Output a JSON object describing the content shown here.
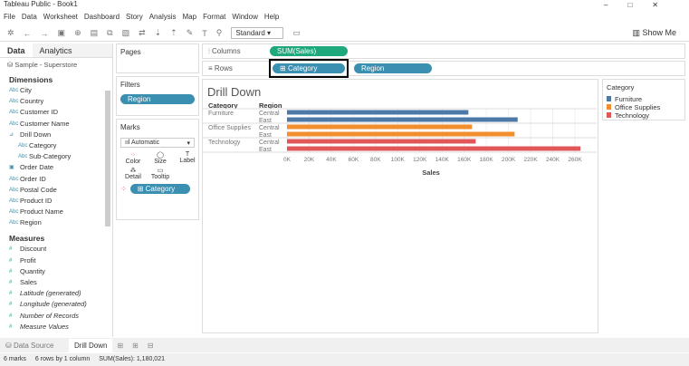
{
  "window": {
    "title": "Tableau Public - Book1"
  },
  "menu": [
    "File",
    "Data",
    "Worksheet",
    "Dashboard",
    "Story",
    "Analysis",
    "Map",
    "Format",
    "Window",
    "Help"
  ],
  "toolbar": {
    "view_mode": "Standard",
    "show_me": "Show Me"
  },
  "left": {
    "tab_data": "Data",
    "tab_analytics": "Analytics",
    "datasource": "Sample - Superstore",
    "dimensions_label": "Dimensions",
    "dimensions": [
      "City",
      "Country",
      "Customer ID",
      "Customer Name",
      "Drill Down",
      "Category",
      "Sub-Category",
      "Order Date",
      "Order ID",
      "Postal Code",
      "Product ID",
      "Product Name",
      "Region"
    ],
    "measures_label": "Measures",
    "measures": [
      "Discount",
      "Profit",
      "Quantity",
      "Sales",
      "Latitude (generated)",
      "Longitude (generated)",
      "Number of Records",
      "Measure Values"
    ]
  },
  "cards": {
    "pages": "Pages",
    "filters": "Filters",
    "filter_pill": "Region",
    "marks": "Marks",
    "mark_type": "Automatic",
    "color": "Color",
    "size": "Size",
    "label": "Label",
    "detail": "Detail",
    "tooltip": "Tooltip",
    "color_pill": "Category"
  },
  "shelves": {
    "columns": "Columns",
    "rows": "Rows",
    "columns_pill": "SUM(Sales)",
    "rows_pill1": "Category",
    "rows_pill2": "Region"
  },
  "view": {
    "title": "Drill Down",
    "col_category": "Category",
    "col_region": "Region"
  },
  "legend": {
    "title": "Category",
    "items": [
      "Furniture",
      "Office Supplies",
      "Technology"
    ]
  },
  "colors": {
    "Furniture": "#4e79a7",
    "Office Supplies": "#f28e2b",
    "Technology": "#e15759"
  },
  "chart_data": {
    "type": "bar",
    "title": "Drill Down",
    "xlabel": "Sales",
    "xlim": [
      0,
      265000
    ],
    "ticks": [
      "0K",
      "20K",
      "40K",
      "60K",
      "80K",
      "100K",
      "120K",
      "140K",
      "160K",
      "180K",
      "200K",
      "220K",
      "240K",
      "260K"
    ],
    "rows": [
      {
        "category": "Furniture",
        "region": "Central",
        "value": 163797
      },
      {
        "category": "Furniture",
        "region": "East",
        "value": 208291
      },
      {
        "category": "Office Supplies",
        "region": "Central",
        "value": 167026
      },
      {
        "category": "Office Supplies",
        "region": "East",
        "value": 205516
      },
      {
        "category": "Technology",
        "region": "Central",
        "value": 170416
      },
      {
        "category": "Technology",
        "region": "East",
        "value": 264974
      }
    ]
  },
  "sheets": {
    "datasource": "Data Source",
    "current": "Drill Down"
  },
  "status": {
    "marks": "6 marks",
    "dims": "6 rows by 1 column",
    "sum": "SUM(Sales): 1,180,021"
  }
}
